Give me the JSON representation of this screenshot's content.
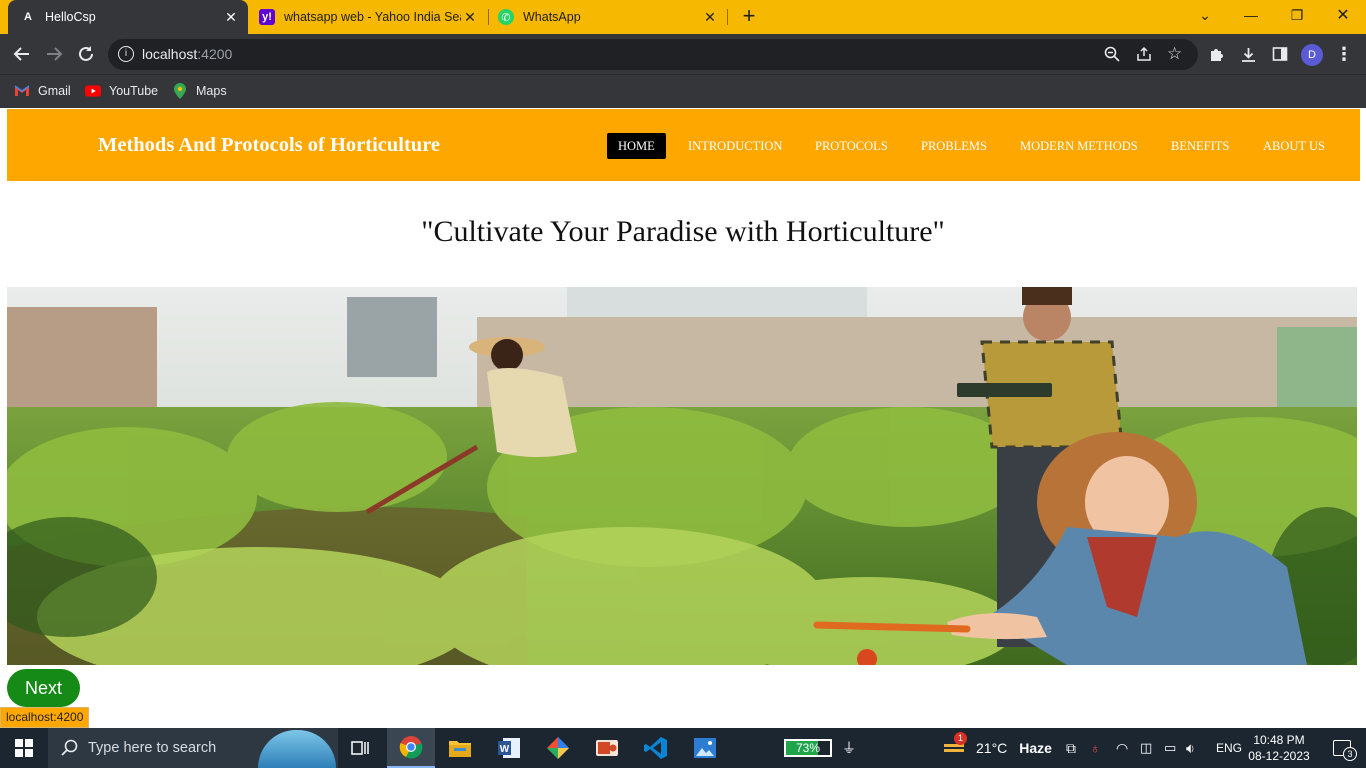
{
  "browser": {
    "tabs": [
      {
        "title": "HelloCsp",
        "icon": "angular-icon",
        "active": true
      },
      {
        "title": "whatsapp web - Yahoo India Sear",
        "icon": "yahoo-icon",
        "active": false
      },
      {
        "title": "WhatsApp",
        "icon": "whatsapp-icon",
        "active": false
      }
    ],
    "address": {
      "host": "localhost",
      "port": ":4200"
    },
    "bookmarks": [
      {
        "label": "Gmail",
        "icon": "gmail-icon"
      },
      {
        "label": "YouTube",
        "icon": "youtube-icon"
      },
      {
        "label": "Maps",
        "icon": "maps-icon"
      }
    ],
    "profile_initial": "D",
    "status_url": "localhost:4200",
    "colors": {
      "tab_strip": "#f6b800",
      "toolbar": "#35363a"
    }
  },
  "site": {
    "brand": "Methods And Protocols of Horticulture",
    "nav": [
      {
        "label": "HOME",
        "active": true
      },
      {
        "label": "INTRODUCTION",
        "active": false
      },
      {
        "label": "PROTOCOLS",
        "active": false
      },
      {
        "label": "PROBLEMS",
        "active": false
      },
      {
        "label": "MODERN METHODS",
        "active": false
      },
      {
        "label": "BENEFITS",
        "active": false
      },
      {
        "label": "ABOUT US",
        "active": false
      }
    ],
    "tagline": "\"Cultivate Your Paradise with Horticulture\"",
    "next_label": "Next",
    "colors": {
      "navbar": "#ffa701",
      "next_button": "#168a16",
      "active_nav": "#000000"
    }
  },
  "taskbar": {
    "search_placeholder": "Type here to search",
    "apps": [
      "task-view-icon",
      "chrome-icon",
      "file-explorer-icon",
      "word-icon",
      "git-icon",
      "powerpoint-icon",
      "vscode-icon",
      "photos-icon"
    ],
    "battery": "73%",
    "weather": {
      "temp": "21°C",
      "condition": "Haze",
      "badge": "1"
    },
    "language": "ENG",
    "time": "10:48 PM",
    "date": "08-12-2023",
    "notifications": "3"
  }
}
